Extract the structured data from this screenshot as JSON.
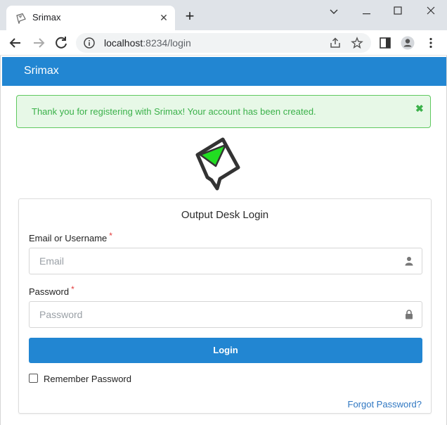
{
  "browser": {
    "tab_title": "Srimax",
    "url_host": "localhost",
    "url_rest": ":8234/login"
  },
  "app": {
    "brand": "Srimax"
  },
  "alert": {
    "message": "Thank you for registering with Srimax! Your account has been created.",
    "close_symbol": "✖"
  },
  "login": {
    "title": "Output Desk Login",
    "email_label": "Email or Username",
    "email_placeholder": "Email",
    "password_label": "Password",
    "password_placeholder": "Password",
    "required_mark": "*",
    "login_button": "Login",
    "remember_label": "Remember Password",
    "forgot_link": "Forgot Password?"
  },
  "colors": {
    "brand_blue": "#2286d2",
    "success_green": "#3bb14a",
    "logo_green": "#22dd22"
  }
}
